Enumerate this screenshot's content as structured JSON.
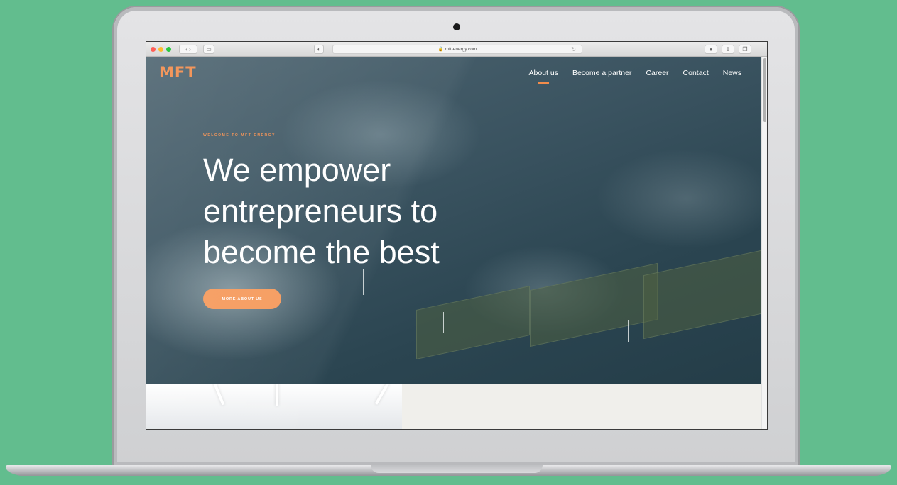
{
  "browser": {
    "url": "mft-energy.com",
    "traffic_colors": [
      "#ff5f57",
      "#febc2e",
      "#28c840"
    ]
  },
  "site": {
    "logo": "MFT",
    "accent_color": "#f28c4b",
    "nav": [
      {
        "label": "About us",
        "active": true
      },
      {
        "label": "Become a partner",
        "active": false
      },
      {
        "label": "Career",
        "active": false
      },
      {
        "label": "Contact",
        "active": false
      },
      {
        "label": "News",
        "active": false
      }
    ],
    "eyebrow": "WELCOME TO MFT ENERGY",
    "headline": [
      "We empower",
      "entrepreneurs to",
      "become the best"
    ],
    "cta_label": "MORE ABOUT US"
  }
}
